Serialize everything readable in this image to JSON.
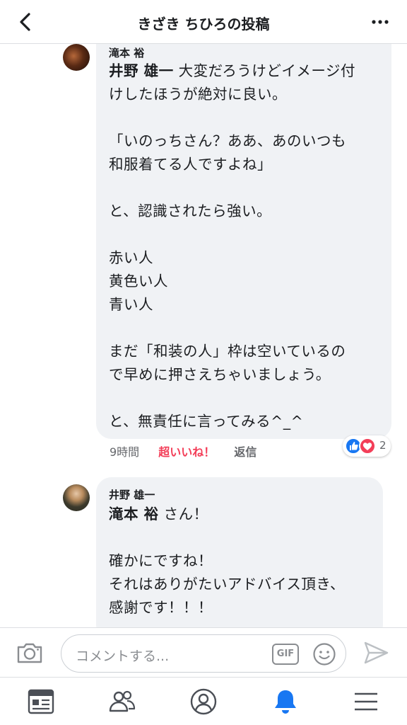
{
  "header": {
    "title": "きざき ちひろの投稿"
  },
  "comments": [
    {
      "author": "滝本 裕",
      "mention": "井野 雄一",
      "text_after_mention": " 大変だろうけどイメージ付\nけしたほうが絶対に良い。\n\n「いのっちさん？ああ、あのいつも\n和服着てる人ですよね」\n\nと、認識されたら強い。\n\n赤い人\n黄色い人\n青い人\n\nまだ「和装の人」枠は空いているの\nで早めに押さえちゃいましょう。\n\nと、無責任に言ってみる^_^",
      "time": "9時間",
      "reaction_label": "超いいね！",
      "reply_label": "返信",
      "reaction_count": "2"
    },
    {
      "author": "井野 雄一",
      "mention": "滝本 裕",
      "text_after_mention": " さん！\n\n確かにですね！\nそれはありがたいアドバイス頂き、\n感謝です！！！"
    }
  ],
  "composer": {
    "placeholder": "コメントする...",
    "gif_label": "GIF"
  },
  "icons": {
    "back": "chevron-left-icon",
    "more": "more-horizontal-icon",
    "camera": "camera-icon",
    "emoji": "smiley-icon",
    "send": "send-icon",
    "like_reaction": "thumbs-up-icon",
    "love_reaction": "heart-icon",
    "tabs": [
      "news-feed-icon",
      "friends-icon",
      "profile-icon",
      "notifications-bell-icon",
      "menu-icon"
    ]
  },
  "colors": {
    "accent": "#1877f2",
    "love": "#f33e58",
    "bubble": "#f0f2f5",
    "secondary_text": "#65676b"
  }
}
